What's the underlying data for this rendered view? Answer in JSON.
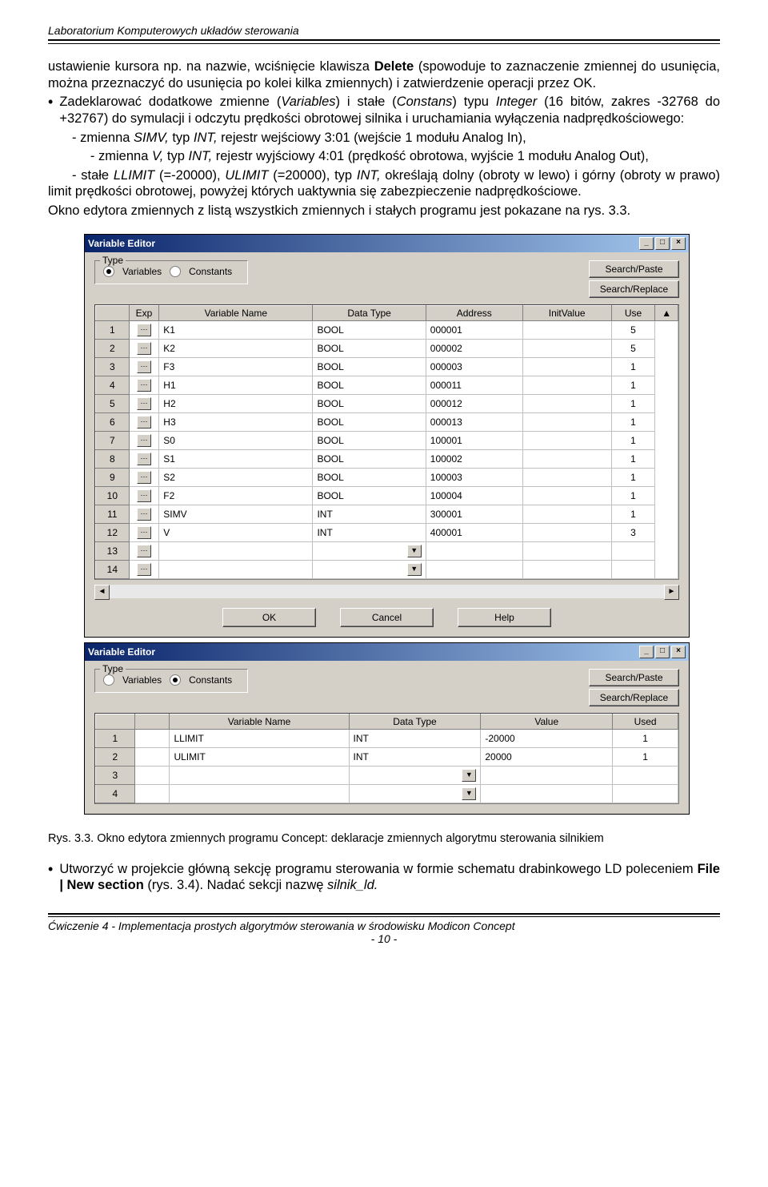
{
  "header": "Laboratorium Komputerowych układów sterowania",
  "para1": {
    "t1": "ustawienie kursora np. na nazwie, wciśnięcie klawisza ",
    "bold1": "Delete",
    "t2": " (spowoduje to zaznaczenie zmiennej do usunięcia, można przeznaczyć do usunięcia po kolei kilka zmiennych) i zatwierdzenie operacji przez OK."
  },
  "bulleted1": {
    "t1": "Zadeklarować dodatkowe zmienne (",
    "i1": "Variables",
    "t2": ") i stałe (",
    "i2": "Constans",
    "t3": ") typu ",
    "i3": "Integer",
    "t4": " (16 bitów, zakres -32768 do +32767) do symulacji i odczytu prędkości obrotowej silnika i uruchamiania wyłączenia nadprędkościowego:"
  },
  "line_simv": {
    "t1": "- zmienna ",
    "i1": "SIMV,",
    "t2": " typ ",
    "i2": "INT,",
    "t3": " rejestr wejściowy 3:01 (wejście 1 modułu Analog In),"
  },
  "line_v": {
    "t1": "- zmienna ",
    "i1": "V,",
    "t2": " typ ",
    "i2": "INT,",
    "t3": " rejestr wyjściowy 4:01 (prędkość obrotowa, wyjście 1 modułu Analog Out),"
  },
  "line_llimit": {
    "t1": "- stałe ",
    "i1": "LLIMIT",
    "t2": " (=-20000), ",
    "i2": "ULIMIT",
    "t3": " (=20000), typ ",
    "i3": "INT,",
    "t4": " określają dolny (obroty w lewo) i górny (obroty w prawo) limit prędkości obrotowej, powyżej których uaktywnia się zabezpieczenie nadprędkościowe."
  },
  "para_fig": "Okno edytora zmiennych z listą wszystkich zmiennych i stałych programu jest pokazane na rys. 3.3.",
  "ve": {
    "title": "Variable Editor",
    "type_legend": "Type",
    "rb_variables": "Variables",
    "rb_constants": "Constants",
    "btn_search_paste": "Search/Paste",
    "btn_search_replace": "Search/Replace",
    "btn_ok": "OK",
    "btn_cancel": "Cancel",
    "btn_help": "Help",
    "headers_vars": [
      "Exp",
      "Variable Name",
      "Data Type",
      "Address",
      "InitValue",
      "Use"
    ],
    "headers_const": [
      "Variable Name",
      "Data Type",
      "Value",
      "Used"
    ],
    "rows_vars": [
      {
        "n": "1",
        "name": "K1",
        "type": "BOOL",
        "addr": "000001",
        "init": "",
        "use": "5"
      },
      {
        "n": "2",
        "name": "K2",
        "type": "BOOL",
        "addr": "000002",
        "init": "",
        "use": "5"
      },
      {
        "n": "3",
        "name": "F3",
        "type": "BOOL",
        "addr": "000003",
        "init": "",
        "use": "1"
      },
      {
        "n": "4",
        "name": "H1",
        "type": "BOOL",
        "addr": "000011",
        "init": "",
        "use": "1"
      },
      {
        "n": "5",
        "name": "H2",
        "type": "BOOL",
        "addr": "000012",
        "init": "",
        "use": "1"
      },
      {
        "n": "6",
        "name": "H3",
        "type": "BOOL",
        "addr": "000013",
        "init": "",
        "use": "1"
      },
      {
        "n": "7",
        "name": "S0",
        "type": "BOOL",
        "addr": "100001",
        "init": "",
        "use": "1"
      },
      {
        "n": "8",
        "name": "S1",
        "type": "BOOL",
        "addr": "100002",
        "init": "",
        "use": "1"
      },
      {
        "n": "9",
        "name": "S2",
        "type": "BOOL",
        "addr": "100003",
        "init": "",
        "use": "1"
      },
      {
        "n": "10",
        "name": "F2",
        "type": "BOOL",
        "addr": "100004",
        "init": "",
        "use": "1"
      },
      {
        "n": "11",
        "name": "SIMV",
        "type": "INT",
        "addr": "300001",
        "init": "",
        "use": "1"
      },
      {
        "n": "12",
        "name": "V",
        "type": "INT",
        "addr": "400001",
        "init": "",
        "use": "3"
      },
      {
        "n": "13",
        "name": "",
        "type": "",
        "addr": "",
        "init": "",
        "use": ""
      },
      {
        "n": "14",
        "name": "",
        "type": "",
        "addr": "",
        "init": "",
        "use": ""
      }
    ],
    "rows_const": [
      {
        "n": "1",
        "name": "LLIMIT",
        "type": "INT",
        "val": "-20000",
        "used": "1"
      },
      {
        "n": "2",
        "name": "ULIMIT",
        "type": "INT",
        "val": "20000",
        "used": "1"
      },
      {
        "n": "3",
        "name": "",
        "type": "",
        "val": "",
        "used": ""
      },
      {
        "n": "4",
        "name": "",
        "type": "",
        "val": "",
        "used": ""
      }
    ]
  },
  "caption": "Rys. 3.3. Okno edytora zmiennych programu Concept: deklaracje zmiennych algorytmu sterowania silnikiem",
  "bulleted2": {
    "t1": "Utworzyć w projekcie główną sekcję programu sterowania w formie schematu drabinkowego LD poleceniem ",
    "b1": "File | New section",
    "t2": " (rys. 3.4). Nadać sekcji nazwę ",
    "i1": "silnik_ld.",
    "t3": ""
  },
  "footer_left": "Ćwiczenie 4 - Implementacja prostych algorytmów sterowania w środowisku Modicon Concept",
  "footer_right": "- 10 -"
}
